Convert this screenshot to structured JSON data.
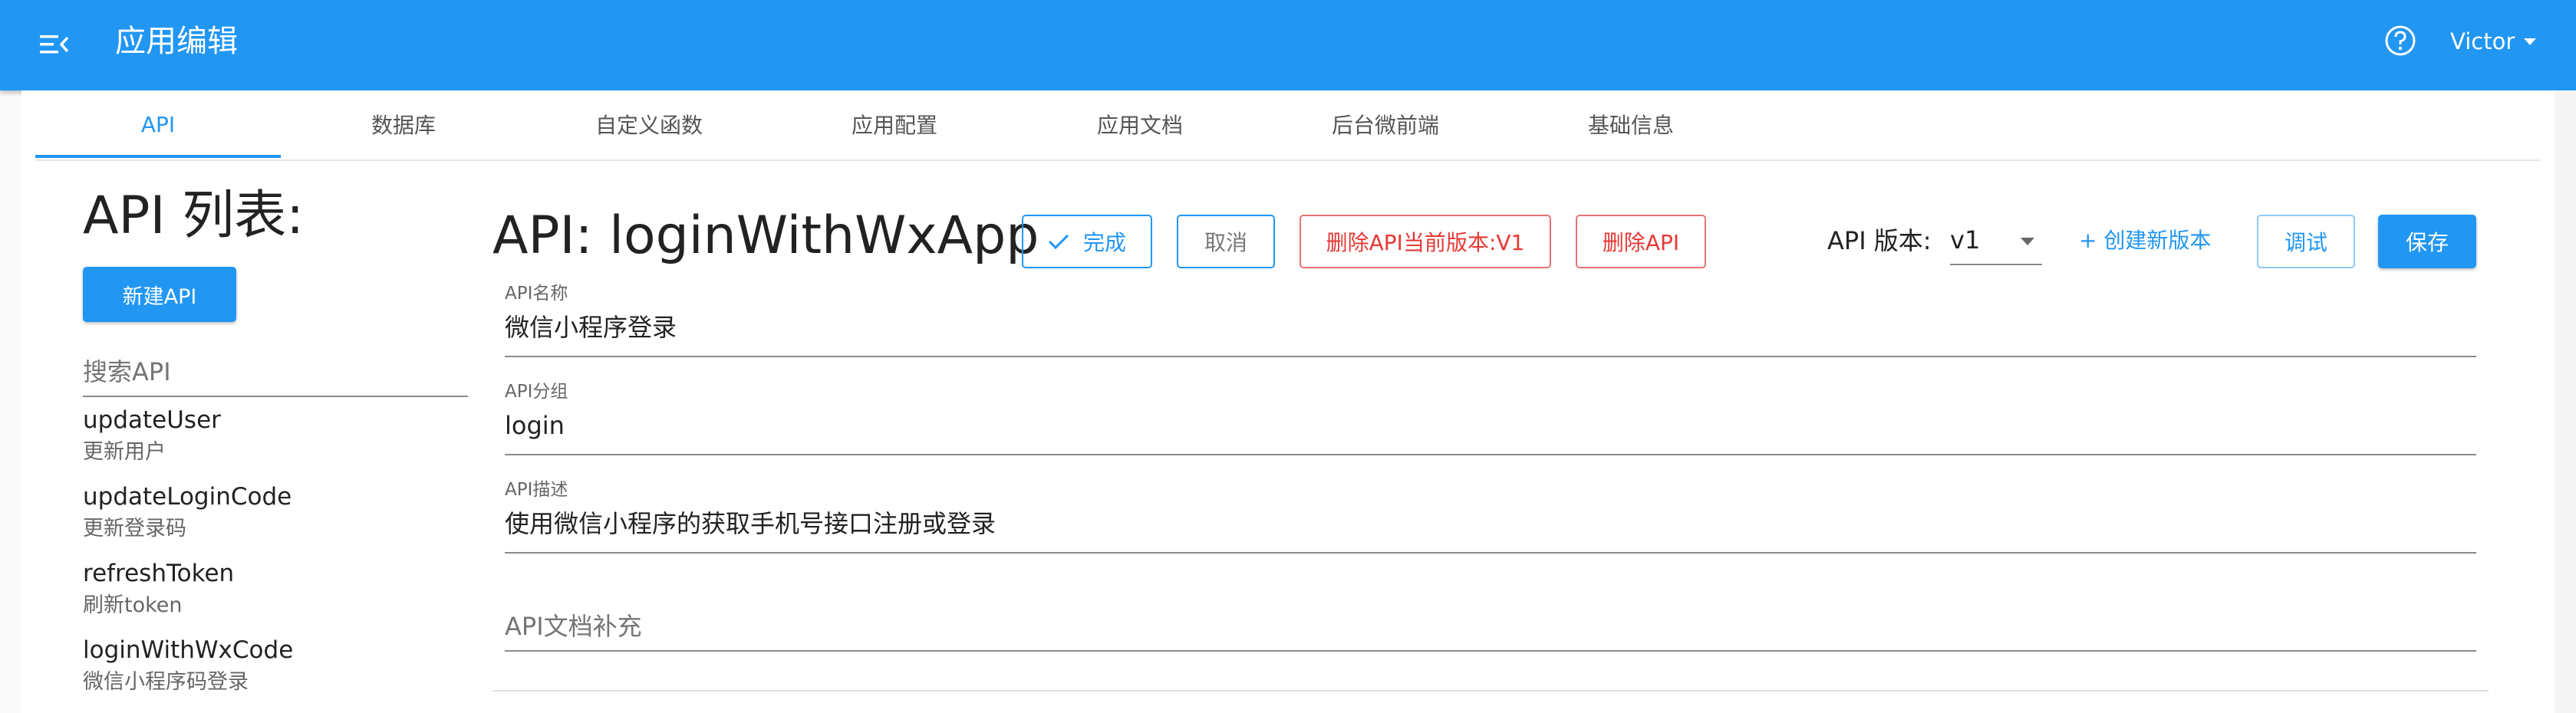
{
  "header": {
    "title": "应用编辑",
    "menu_icon": "menu-fold-icon",
    "help_icon": "help-circle-icon",
    "user_name": "Victor"
  },
  "tabs": [
    {
      "label": "API",
      "active": true
    },
    {
      "label": "数据库"
    },
    {
      "label": "自定义函数"
    },
    {
      "label": "应用配置"
    },
    {
      "label": "应用文档"
    },
    {
      "label": "后台微前端"
    },
    {
      "label": "基础信息"
    }
  ],
  "sidebar": {
    "title": "API 列表:",
    "new_button": "新建API",
    "search_placeholder": "搜索API",
    "items": [
      {
        "name": "updateUser",
        "desc": "更新用户"
      },
      {
        "name": "updateLoginCode",
        "desc": "更新登录码"
      },
      {
        "name": "refreshToken",
        "desc": "刷新token"
      },
      {
        "name": "loginWithWxCode",
        "desc": "微信小程序码登录"
      }
    ]
  },
  "editor": {
    "heading": "API: loginWithWxApp",
    "done_button": "完成",
    "cancel_button": "取消",
    "delete_version_button": "删除API当前版本:V1",
    "delete_api_button": "删除API",
    "version_label": "API 版本:",
    "version_value": "v1",
    "create_version_link": "+ 创建新版本",
    "debug_button": "调试",
    "save_button": "保存",
    "fields": [
      {
        "label": "API名称",
        "value": "微信小程序登录"
      },
      {
        "label": "API分组",
        "value": "login"
      },
      {
        "label": "API描述",
        "value": "使用微信小程序的获取手机号接口注册或登录"
      }
    ],
    "doc_placeholder": "API文档补充"
  },
  "colors": {
    "primary": "#2196f3",
    "danger": "#e53935"
  }
}
